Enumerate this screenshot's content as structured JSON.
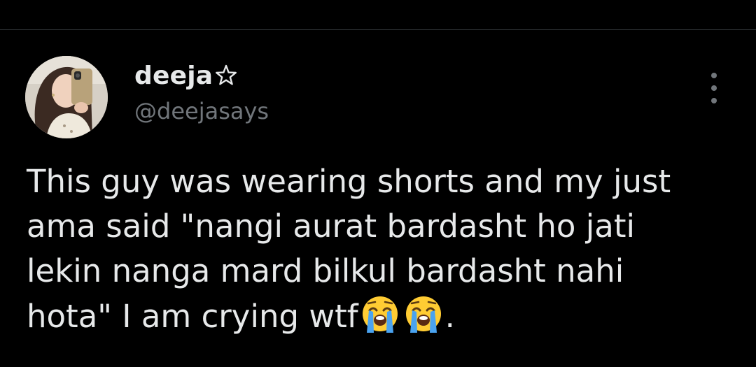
{
  "tweet": {
    "author": {
      "display_name": "deeja",
      "name_icon": "star-icon",
      "handle": "@deejasays",
      "avatar_icon": "avatar-photo"
    },
    "more_icon": "more-vertical-icon",
    "text_lines": [
      "This guy was wearing shorts and my just",
      "ama said \"nangi aurat bardasht ho jati",
      "lekin nanga mard bilkul bardasht nahi",
      "hota\" I am crying wtf"
    ],
    "text_suffix": ".",
    "emojis": [
      "loudly-crying-face-icon",
      "loudly-crying-face-icon"
    ]
  },
  "colors": {
    "background": "#000000",
    "primary_text": "#e7e9ea",
    "secondary_text": "#71767b",
    "divider": "#2f3336",
    "emoji_face": "#ffcc33",
    "emoji_tears": "#4aa3f0"
  }
}
